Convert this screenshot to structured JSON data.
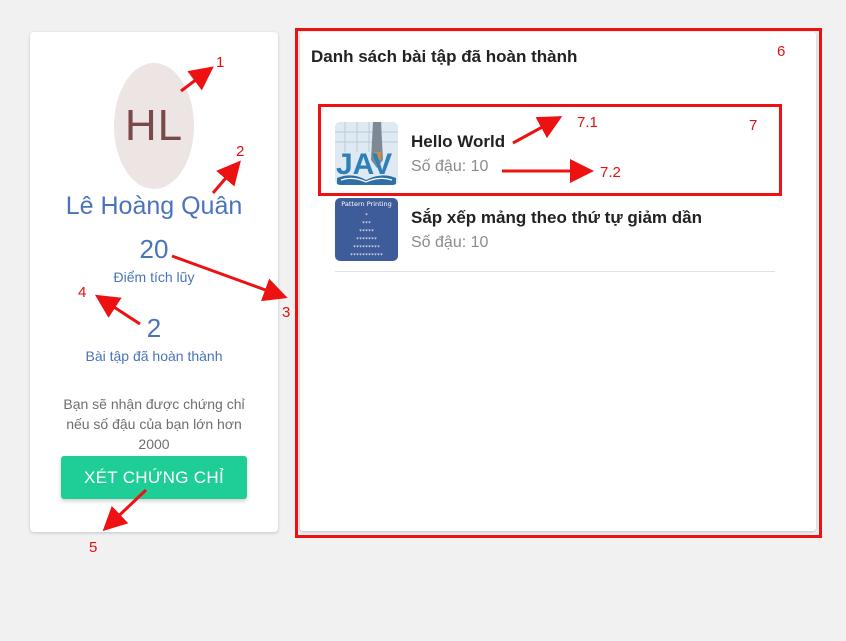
{
  "profile": {
    "avatar_initials": "HL",
    "name": "Lê Hoàng Quân",
    "points_value": "20",
    "points_label": "Điểm tích lũy",
    "completed_value": "2",
    "completed_label": "Bài tập đã hoàn thành",
    "note_text": "Bạn sẽ nhận được chứng chỉ nếu số đậu của bạn lớn hơn 2000",
    "certificate_button": "XÉT CHỨNG CHỈ"
  },
  "completed_list": {
    "title": "Danh sách bài tập đã hoàn thành",
    "items": [
      {
        "name": "Hello World",
        "score": "Số đậu: 10",
        "thumb_icon": "java-book-icon"
      },
      {
        "name": "Sắp xếp mảng theo thứ tự giảm dần",
        "score": "Số đậu: 10",
        "thumb_icon": "pattern-printing-icon"
      }
    ],
    "thumb_caption": "Pattern Printing"
  },
  "annotations": {
    "labels": [
      "1",
      "2",
      "3",
      "4",
      "5",
      "6",
      "7",
      "7.1",
      "7.2"
    ],
    "color": "#ee1111"
  },
  "colors": {
    "accent_blue": "#4a74b9",
    "button_green": "#1fce96",
    "background": "#f1f1f1"
  }
}
